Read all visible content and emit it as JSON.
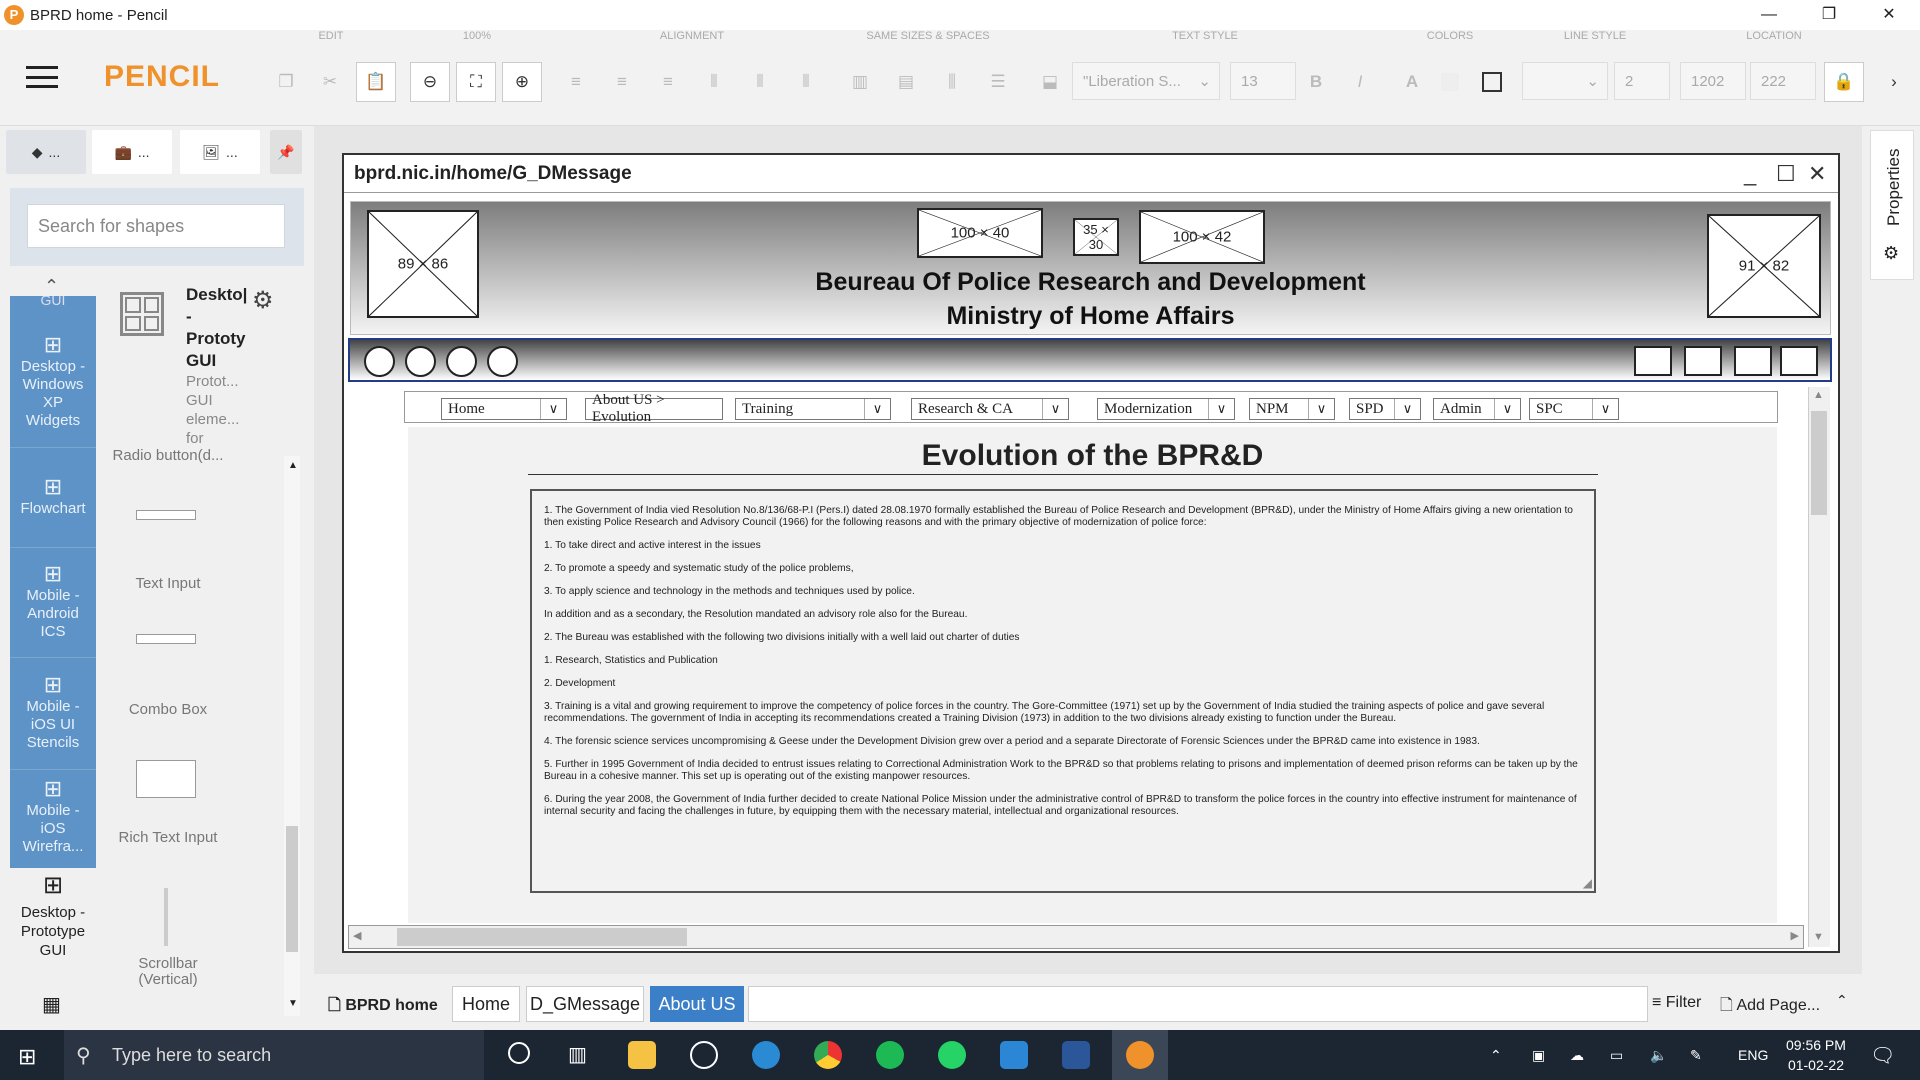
{
  "window": {
    "title": "BPRD home - Pencil",
    "app_icon": "pencil-app-icon",
    "min": "—",
    "max": "❐",
    "close": "✕"
  },
  "toolbar": {
    "brand": "PENCIL",
    "groups": {
      "edit": "EDIT",
      "zoom": "100%",
      "alignment": "ALIGNMENT",
      "same_sizes": "SAME SIZES & SPACES",
      "text_style": "TEXT STYLE",
      "colors": "COLORS",
      "line_style": "LINE STYLE",
      "location": "LOCATION"
    },
    "font_name": "\"Liberation S...",
    "font_size": "13",
    "bold": "B",
    "italic": "I",
    "text_color": "A",
    "line_width": "2",
    "loc_x": "1202",
    "loc_y": "222"
  },
  "sidebar": {
    "tabs": [
      "...",
      "...",
      "..."
    ],
    "search_placeholder": "Search for shapes",
    "collections": [
      {
        "label": "GUI"
      },
      {
        "label": "Desktop - Windows XP Widgets"
      },
      {
        "label": "Flowchart"
      },
      {
        "label": "Mobile - Android ICS"
      },
      {
        "label": "Mobile - iOS UI Stencils"
      },
      {
        "label": "Mobile - iOS Wirefra..."
      }
    ],
    "active_collection": "Desktop - Prototype GUI",
    "collection_header": {
      "name": "Deskto| - Prototy GUI",
      "desc": "Protot... GUI eleme... for"
    },
    "shapes": [
      "Radio button(d...",
      "Text Input",
      "Combo Box",
      "Rich Text Input",
      "Scrollbar (Vertical)"
    ]
  },
  "canvas": {
    "url": "bprd.nic.in/home/G_DMessage",
    "placeholders": {
      "logo_left": "89 × 86",
      "top1": "100 × 40",
      "top2": "35 × 30",
      "top3": "100 × 42",
      "logo_right": "91 × 82"
    },
    "header_line1": "Beureau Of Police Research and Development",
    "header_line2": "Ministry of Home Affairs",
    "menu": [
      "Home",
      "About US > Evolution",
      "Training",
      "Research & CA",
      "Modernization",
      "NPM",
      "SPD",
      "Admin",
      "SPC"
    ],
    "page_title": "Evolution of the BPR&D",
    "paragraphs": [
      "1. The Government of India vied Resolution No.8/136/68-P.I (Pers.I) dated 28.08.1970 formally established the Bureau of Police Research and Development (BPR&D), under the Ministry of Home Affairs giving a new orientation to then existing Police Research and Advisory Council (1966) for the following reasons and with the primary objective of modernization of police force:",
      "1.    To take direct and active interest in the issues",
      "2.    To promote a speedy and systematic study of the police problems,",
      "3.    To apply science and technology in the methods and techniques used by police.",
      "In addition and as a secondary, the Resolution mandated an advisory role also for the Bureau.",
      "2. The Bureau was established with the following two divisions initially with a well laid out charter of duties",
      "1.    Research, Statistics and Publication",
      "2.    Development",
      "3. Training is a vital and growing requirement to improve the competency of police forces in the country. The Gore-Committee (1971) set up by the Government of India studied the training aspects of police and gave several recommendations. The government of India in accepting its recommendations created a Training Division (1973) in addition to the two divisions already existing to function under the Bureau.",
      "4. The forensic science services uncompromising & Geese under the Development Division grew over a period and a separate Directorate of Forensic Sciences under the BPR&D came into existence in 1983.",
      "5. Further in 1995 Government of India decided to entrust issues relating to Correctional Administration Work to the BPR&D so that problems relating to prisons and implementation of deemed prison reforms can be taken up by the Bureau in a cohesive manner. This set up is operating out of the existing manpower resources.",
      "6. During the year 2008, the Government of India further decided to create National Police Mission under the administrative control of BPR&D to transform the police forces in the country into effective instrument for maintenance of internal security and facing the challenges in future, by equipping them with the necessary material, intellectual and organizational resources."
    ]
  },
  "right_panel": {
    "label": "Properties"
  },
  "pages": {
    "doc": "BPRD home",
    "tabs": [
      "Home",
      "D_GMessage",
      "About US"
    ],
    "selected": "About US",
    "filter": "Filter",
    "add_page": "Add Page..."
  },
  "taskbar": {
    "search": "Type here to search",
    "lang": "ENG",
    "time": "09:56 PM",
    "date": "01-02-22"
  },
  "colors": {
    "brand": "#f0922b",
    "selected_tab": "#3a7fc7",
    "collection": "#5e93c8"
  }
}
